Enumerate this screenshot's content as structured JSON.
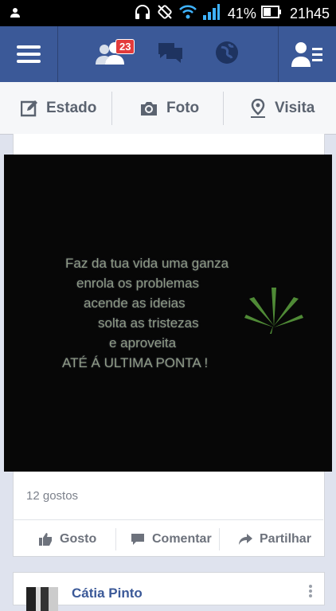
{
  "status": {
    "battery_pct": "41%",
    "time": "21h45"
  },
  "nav": {
    "badge_count": "23"
  },
  "composer": {
    "status_label": "Estado",
    "photo_label": "Foto",
    "checkin_label": "Visita"
  },
  "post": {
    "quote_lines": [
      "Faz da tua vida uma ganza",
      "enrola os problemas",
      "acende as ideias",
      "solta as tristezas",
      "e aproveita",
      "ATÉ Á ULTIMA PONTA !"
    ],
    "likes": "12 gostos",
    "like_label": "Gosto",
    "comment_label": "Comentar",
    "share_label": "Partilhar"
  },
  "next_post": {
    "author": "Cátia Pinto"
  },
  "colors": {
    "brand": "#3b5998",
    "badge": "#e33b3b",
    "status_bar": "#000000"
  }
}
